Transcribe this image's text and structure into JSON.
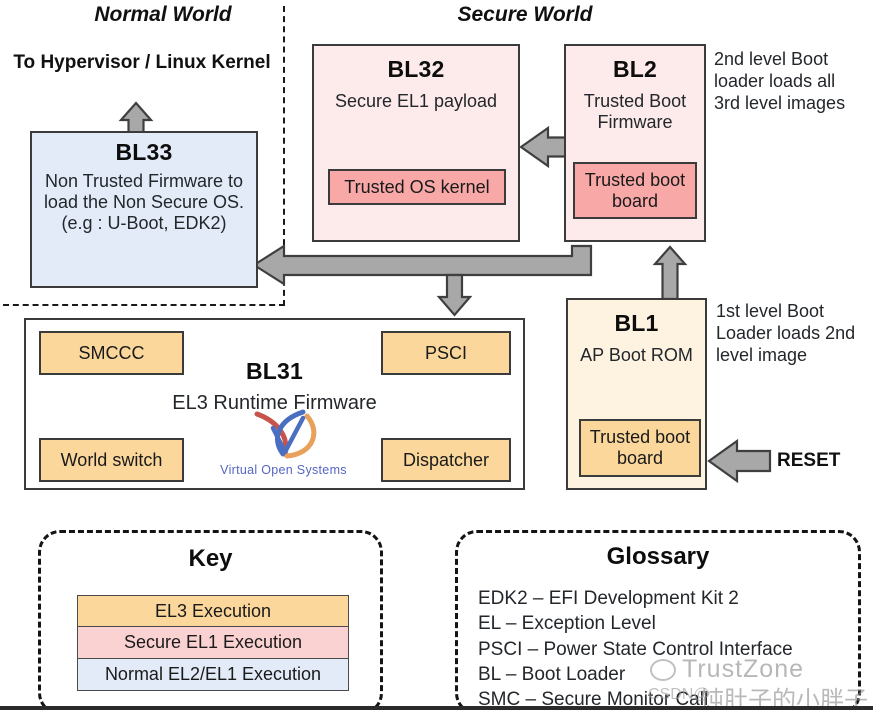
{
  "diagram": {
    "worlds": {
      "normal": "Normal World",
      "secure": "Secure World"
    },
    "labels": {
      "to_hypervisor": "To Hypervisor / Linux Kernel",
      "reset": "RESET"
    },
    "boxes": {
      "bl33": {
        "title": "BL33",
        "subtitle": "Non Trusted Firmware to load the Non Secure OS. (e.g : U-Boot, EDK2)"
      },
      "bl32": {
        "title": "BL32",
        "subtitle": "Secure EL1 payload",
        "chip": "Trusted OS kernel"
      },
      "bl2": {
        "title": "BL2",
        "subtitle": "Trusted Boot Firmware",
        "chip": "Trusted boot board",
        "note": "2nd level Boot loader loads all 3rd level images"
      },
      "bl31": {
        "title": "BL31",
        "subtitle": "EL3 Runtime Firmware",
        "chips": [
          "SMCCC",
          "PSCI",
          "World switch",
          "Dispatcher"
        ],
        "logo_text": "Virtual Open Systems"
      },
      "bl1": {
        "title": "BL1",
        "subtitle": "AP Boot ROM",
        "chip": "Trusted boot board",
        "note": "1st level Boot Loader loads 2nd level image"
      }
    },
    "key": {
      "title": "Key",
      "rows": [
        "EL3 Execution",
        "Secure EL1 Execution",
        "Normal EL2/EL1 Execution"
      ]
    },
    "glossary": {
      "title": "Glossary",
      "entries": [
        "EDK2 – EFI Development Kit 2",
        "EL – Exception Level",
        "PSCI – Power State Control Interface",
        "BL – Boot Loader",
        "SMC – Secure Monitor Call"
      ]
    },
    "watermark": {
      "brand": "TrustZone",
      "chinese": "饨肚子的小胖子",
      "csdn": "CSDN@"
    },
    "colors": {
      "normal_world_fill": "#e2ebf7",
      "secure_el1_fill": "#fdeaea",
      "secure_el1_chip": "#f9a8a8",
      "el3_fill": "#fdf3e0",
      "el3_chip": "#fbd79b",
      "arrow_fill": "#a8a8a8",
      "stroke": "#3b3b3b"
    }
  }
}
